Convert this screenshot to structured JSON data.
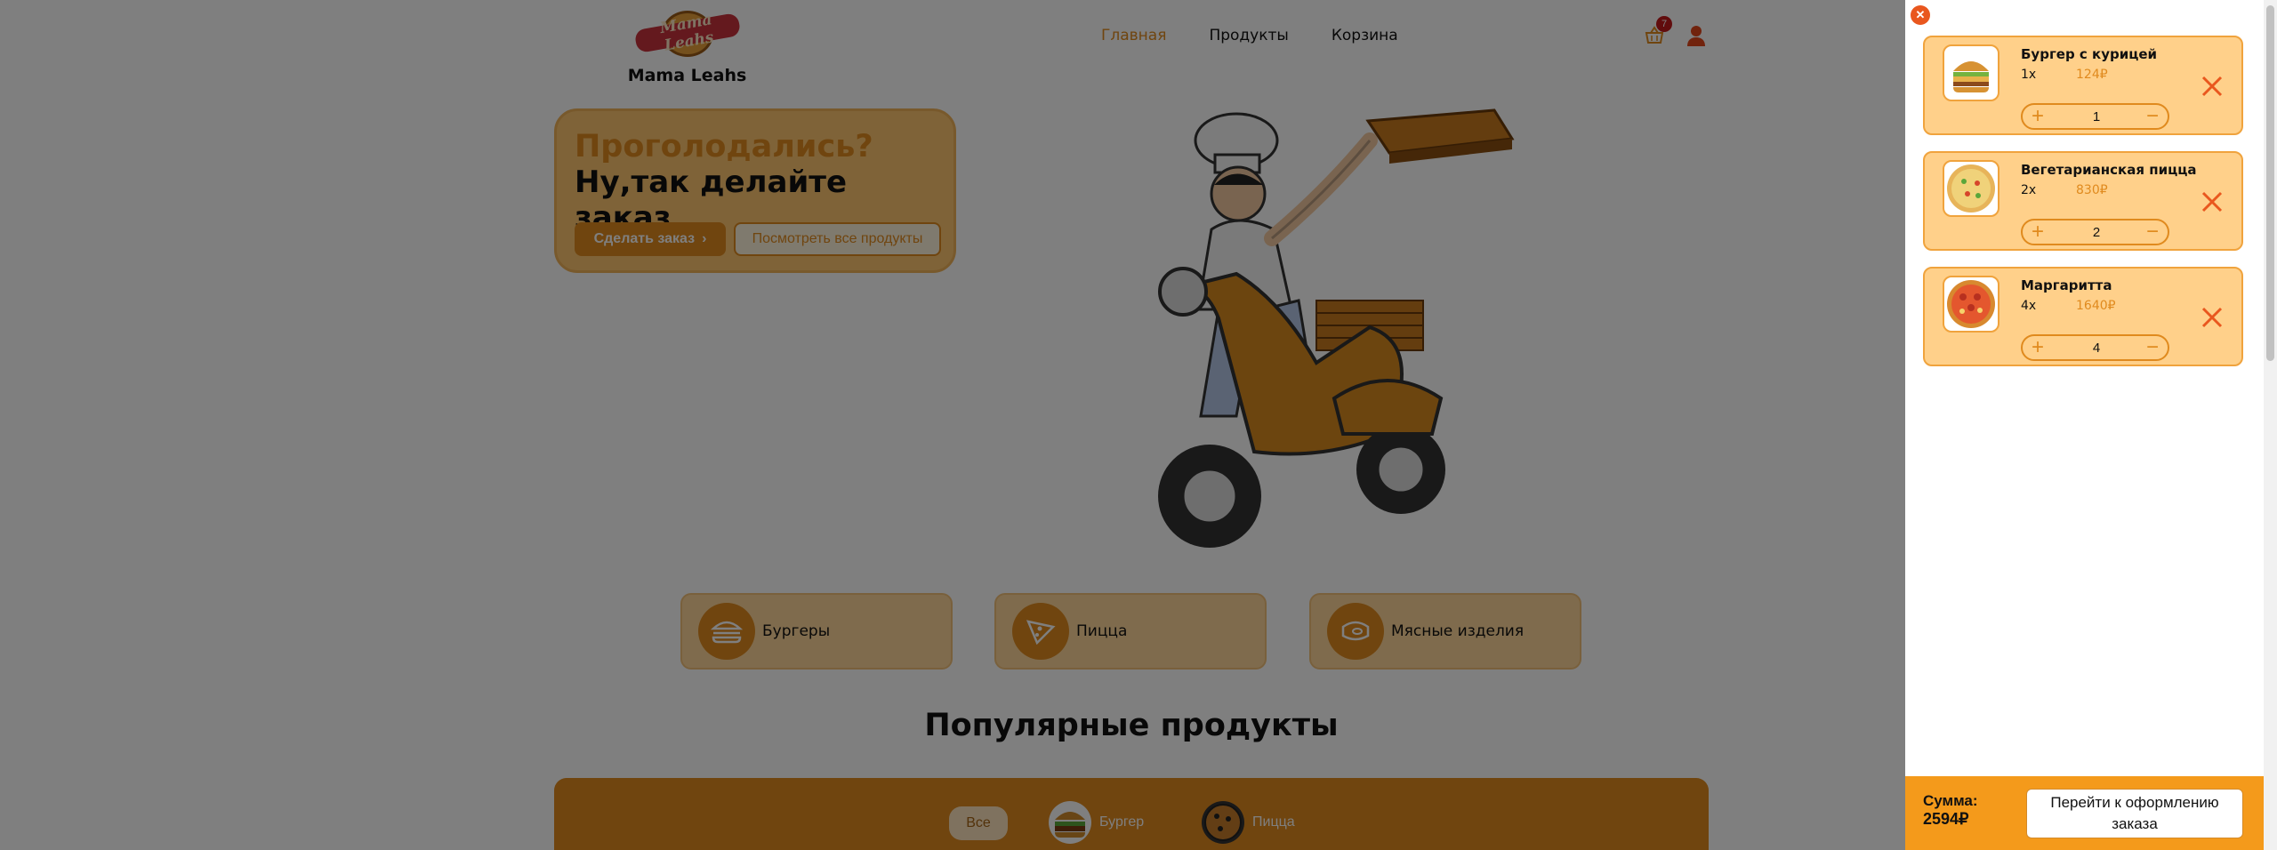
{
  "brand": {
    "logo_text": "Mama Leahs",
    "name": "Mama Leahs"
  },
  "nav": {
    "items": [
      "Главная",
      "Продукты",
      "Корзина"
    ],
    "active": "Главная"
  },
  "header": {
    "cart_count": "7"
  },
  "hero": {
    "question": "Проголодались?",
    "tagline": "Ну,так делайте заказ",
    "order_button": "Сделать заказ",
    "all_products_button": "Посмотреть все продукты"
  },
  "categories": [
    {
      "label": "Бургеры",
      "icon": "burger-icon"
    },
    {
      "label": "Пицца",
      "icon": "pizza-icon"
    },
    {
      "label": "Мясные изделия",
      "icon": "meat-icon"
    }
  ],
  "popular": {
    "title": "Популярные продукты",
    "filters": [
      "Все",
      "Бургер",
      "Пицца"
    ]
  },
  "cart": {
    "items": [
      {
        "name": "Бургер с курицей",
        "qty_label": "1x",
        "price": "124₽",
        "qty": "1"
      },
      {
        "name": "Вегетарианская пицца",
        "qty_label": "2x",
        "price": "830₽",
        "qty": "2"
      },
      {
        "name": "Маргаритта",
        "qty_label": "4x",
        "price": "1640₽",
        "qty": "4"
      }
    ],
    "sum_label": "Сумма:",
    "sum_value": "2594₽",
    "checkout_label": "Перейти к оформлению заказа"
  },
  "colors": {
    "accent": "#e08a1e",
    "card": "#ffd08a",
    "summary": "#f49a1b",
    "close": "#e9571e"
  }
}
